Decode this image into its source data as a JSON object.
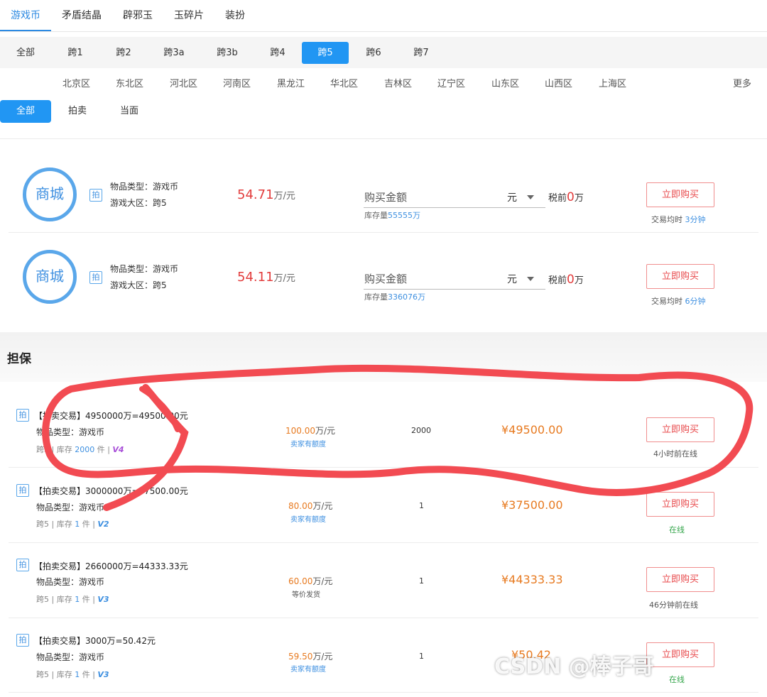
{
  "category_tabs": [
    "游戏币",
    "矛盾结晶",
    "辟邪玉",
    "玉碎片",
    "装扮"
  ],
  "server_tabs": [
    "全部",
    "跨1",
    "跨2",
    "跨3a",
    "跨3b",
    "跨4",
    "跨5",
    "跨6",
    "跨7"
  ],
  "regions": [
    "北京区",
    "东北区",
    "河北区",
    "河南区",
    "黑龙江",
    "华北区",
    "吉林区",
    "辽宁区",
    "山东区",
    "山西区",
    "上海区"
  ],
  "more_label": "更多",
  "trade_types": [
    "全部",
    "拍卖",
    "当面"
  ],
  "mall": [
    {
      "logo": "商城",
      "badge": "拍",
      "type_line": "物品类型：游戏币",
      "area_line": "游戏大区：跨5",
      "price": "54.71",
      "price_unit": "万/元",
      "buy_placeholder": "购买金额",
      "currency": "元",
      "stock_label": "库存量",
      "stock_value": "55555万",
      "pretax_label": "税前",
      "pretax_value": "0",
      "pretax_unit": "万",
      "buy_label": "立即购买",
      "avg_label": "交易均时",
      "avg_value": "3分钟"
    },
    {
      "logo": "商城",
      "badge": "拍",
      "type_line": "物品类型：游戏币",
      "area_line": "游戏大区：跨5",
      "price": "54.11",
      "price_unit": "万/元",
      "buy_placeholder": "购买金额",
      "currency": "元",
      "stock_label": "库存量",
      "stock_value": "336076万",
      "pretax_label": "税前",
      "pretax_value": "0",
      "pretax_unit": "万",
      "buy_label": "立即购买",
      "avg_label": "交易均时",
      "avg_value": "6分钟"
    }
  ],
  "escrow_title": "担保",
  "escrow": [
    {
      "badge": "拍",
      "title": "【拍卖交易】4950000万=49500.00元",
      "type_line": "物品类型：游戏币",
      "server": "跨5",
      "stock_label": "库存",
      "stock_value": "2000",
      "stock_unit": "件",
      "level": "V4",
      "unit_price": "100.00",
      "unit_label": "万/元",
      "note": "卖家有额度",
      "qty": "2000",
      "total": "¥49500.00",
      "buy_label": "立即购买",
      "online": "4小时前在线"
    },
    {
      "badge": "拍",
      "title": "【拍卖交易】3000000万=37500.00元",
      "type_line": "物品类型：游戏币",
      "server": "跨5",
      "stock_label": "库存",
      "stock_value": "1",
      "stock_unit": "件",
      "level": "V2",
      "unit_price": "80.00",
      "unit_label": "万/元",
      "note": "卖家有额度",
      "qty": "1",
      "total": "¥37500.00",
      "buy_label": "立即购买",
      "online": "在线"
    },
    {
      "badge": "拍",
      "title": "【拍卖交易】2660000万=44333.33元",
      "type_line": "物品类型：游戏币",
      "server": "跨5",
      "stock_label": "库存",
      "stock_value": "1",
      "stock_unit": "件",
      "level": "V3",
      "unit_price": "60.00",
      "unit_label": "万/元",
      "note": "等价发货",
      "qty": "1",
      "total": "¥44333.33",
      "buy_label": "立即购买",
      "online": "46分钟前在线"
    },
    {
      "badge": "拍",
      "title": "【拍卖交易】3000万=50.42元",
      "type_line": "物品类型：游戏币",
      "server": "跨5",
      "stock_label": "库存",
      "stock_value": "1",
      "stock_unit": "件",
      "level": "V3",
      "unit_price": "59.50",
      "unit_label": "万/元",
      "note": "卖家有额度",
      "qty": "1",
      "total": "¥50.42",
      "buy_label": "立即购买",
      "online": "在线"
    }
  ],
  "watermark": "CSDN @棒子哥",
  "colors": {
    "accent": "#2196f3",
    "price_red": "#e23c3c",
    "price_orange": "#e77a20",
    "annotation": "#f24b52"
  }
}
